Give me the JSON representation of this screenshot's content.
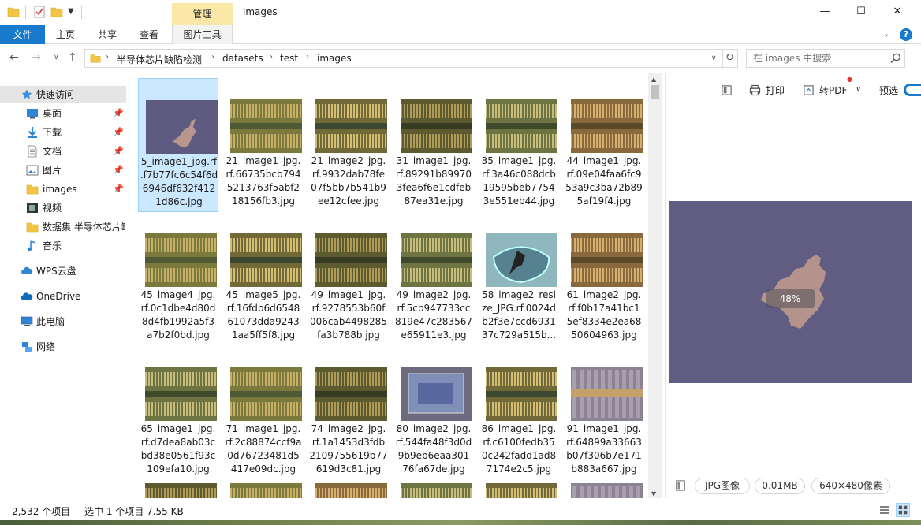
{
  "window": {
    "title": "images",
    "manage_tab": "管理",
    "min_glyph": "—",
    "max_glyph": "☐",
    "close_glyph": "✕"
  },
  "ribbon": {
    "tabs": [
      "文件",
      "主页",
      "共享",
      "查看",
      "图片工具"
    ],
    "file_tab_color": "#1979ca",
    "manage_tab_color": "#fbe7a8"
  },
  "navigation": {
    "breadcrumb": [
      "半导体芯片缺陷检测",
      "datasets",
      "test",
      "images"
    ],
    "search_placeholder": "在 images 中搜索"
  },
  "sidebar": {
    "items": [
      {
        "label": "快速访问",
        "icon": "star-icon",
        "pinned": false
      },
      {
        "label": "桌面",
        "icon": "desktop-icon",
        "pinned": true
      },
      {
        "label": "下载",
        "icon": "download-icon",
        "pinned": true
      },
      {
        "label": "文档",
        "icon": "document-icon",
        "pinned": true
      },
      {
        "label": "图片",
        "icon": "pictures-icon",
        "pinned": true
      },
      {
        "label": "images",
        "icon": "folder-icon",
        "pinned": true
      },
      {
        "label": "视频",
        "icon": "video-icon",
        "pinned": false
      },
      {
        "label": "数据集 半导体芯片缺",
        "icon": "folder-icon",
        "pinned": false
      },
      {
        "label": "音乐",
        "icon": "music-icon",
        "pinned": false
      },
      {
        "label": "WPS云盘",
        "icon": "cloud-icon",
        "pinned": false
      },
      {
        "label": "OneDrive",
        "icon": "onedrive-icon",
        "pinned": false
      },
      {
        "label": "此电脑",
        "icon": "computer-icon",
        "pinned": false
      },
      {
        "label": "网络",
        "icon": "network-icon",
        "pinned": false
      }
    ]
  },
  "files": [
    {
      "name": "5_image1_jpg.rf.f7b77fc6c54f6d6946df632f4121d86c.jpg",
      "lines": [
        "5_image1_jpg.rf",
        ".f7b77fc6c54f6d",
        "6946df632f412",
        "1d86c.jpg"
      ],
      "selected": true,
      "style": "blob"
    },
    {
      "name": "21_image1_jpg.rf.66735bcb7945213763f5abf218156fb3.jpg",
      "lines": [
        "21_image1_jpg.",
        "rf.66735bcb794",
        "5213763f5abf2",
        "18156fb3.jpg"
      ],
      "selected": false,
      "style": "chipa"
    },
    {
      "name": "21_image2_jpg.rf.9932dab78fe07f5bb7b541b9ee12cfee.jpg",
      "lines": [
        "21_image2_jpg.",
        "rf.9932dab78fe",
        "07f5bb7b541b9",
        "ee12cfee.jpg"
      ],
      "selected": false,
      "style": "chipb"
    },
    {
      "name": "31_image1_jpg.rf.892918b989703fea6f6e1cdfeb87ea31e.jpg",
      "lines": [
        "31_image1_jpg.",
        "rf.89291b89970",
        "3fea6f6e1cdfeb",
        "87ea31e.jpg"
      ],
      "selected": false,
      "style": "chipc"
    },
    {
      "name": "35_image1_jpg.rf.3a46c088dcb19595beb77543e551eb44.jpg",
      "lines": [
        "35_image1_jpg.",
        "rf.3a46c088dcb",
        "19595beb7754",
        "3e551eb44.jpg"
      ],
      "selected": false,
      "style": "chipd"
    },
    {
      "name": "44_image1_jpg.rf.09e04faa6fc953a9c3ba72b895af19f4.jpg",
      "lines": [
        "44_image1_jpg.",
        "rf.09e04faa6fc9",
        "53a9c3ba72b89",
        "5af19f4.jpg"
      ],
      "selected": false,
      "style": "chipe"
    },
    {
      "name": "45_image4_jpg.rf.0c1dbe4d80d8d4fb1992a5f3a7b2f0bd.jpg",
      "lines": [
        "45_image4_jpg.",
        "rf.0c1dbe4d80d",
        "8d4fb1992a5f3",
        "a7b2f0bd.jpg"
      ],
      "selected": false,
      "style": "chipa"
    },
    {
      "name": "45_image5_jpg.rf.16fdb6d654861073dda92431aa5ff5f8.jpg",
      "lines": [
        "45_image5_jpg.",
        "rf.16fdb6d6548",
        "61073dda9243",
        "1aa5ff5f8.jpg"
      ],
      "selected": false,
      "style": "chipb"
    },
    {
      "name": "49_image1_jpg.rf.9278553b60f006cab4498285fa3b788b.jpg",
      "lines": [
        "49_image1_jpg.",
        "rf.9278553b60f",
        "006cab4498285",
        "fa3b788b.jpg"
      ],
      "selected": false,
      "style": "chipc"
    },
    {
      "name": "49_image2_jpg.rf.5cb947733cc819e47c283567e65911e3.jpg",
      "lines": [
        "49_image2_jpg.",
        "rf.5cb947733cc",
        "819e47c283567",
        "e65911e3.jpg"
      ],
      "selected": false,
      "style": "chipd"
    },
    {
      "name": "58_image2_resize_JPG.rf.0024db2f3e7ccd693137c729a515b...",
      "lines": [
        "58_image2_resi",
        "ze_JPG.rf.0024d",
        "b2f3e7ccd6931",
        "37c729a515b..."
      ],
      "selected": false,
      "style": "teal"
    },
    {
      "name": "61_image2_jpg.rf.f0b17a41bc15ef8334e2ea6850604963.jpg",
      "lines": [
        "61_image2_jpg.",
        "rf.f0b17a41bc1",
        "5ef8334e2ea68",
        "50604963.jpg"
      ],
      "selected": false,
      "style": "chipe"
    },
    {
      "name": "65_image1_jpg.rf.d7dea8ab03cbd38e0561f93c109efa10.jpg",
      "lines": [
        "65_image1_jpg.",
        "rf.d7dea8ab03c",
        "bd38e0561f93c",
        "109efa10.jpg"
      ],
      "selected": false,
      "style": "chipd"
    },
    {
      "name": "71_image1_jpg.rf.2c88874ccf9a0d76723481d5417e09dc.jpg",
      "lines": [
        "71_image1_jpg.",
        "rf.2c88874ccf9a",
        "0d76723481d5",
        "417e09dc.jpg"
      ],
      "selected": false,
      "style": "chipa"
    },
    {
      "name": "74_image2_jpg.rf.1a1453d3fdb2109755619b77619d3c81.jpg",
      "lines": [
        "74_image2_jpg.",
        "rf.1a1453d3fdb",
        "2109755619b77",
        "619d3c81.jpg"
      ],
      "selected": false,
      "style": "chipc"
    },
    {
      "name": "80_image2_jpg.rf.544fa48f3d0d9b9eb6eaa30176fa67de.jpg",
      "lines": [
        "80_image2_jpg.",
        "rf.544fa48f3d0d",
        "9b9eb6eaa301",
        "76fa67de.jpg"
      ],
      "selected": false,
      "style": "blue"
    },
    {
      "name": "86_image1_jpg.rf.c6100fedb350c242fadd1ad87174e2c5.jpg",
      "lines": [
        "86_image1_jpg.",
        "rf.c6100fedb35",
        "0c242fadd1ad8",
        "7174e2c5.jpg"
      ],
      "selected": false,
      "style": "chipb"
    },
    {
      "name": "91_image1_jpg.rf.64899a33663b07f306b7e171b883a667.jpg",
      "lines": [
        "91_image1_jpg.",
        "rf.64899a33663",
        "b07f306b7e171",
        "b883a667.jpg"
      ],
      "selected": false,
      "style": "purple"
    }
  ],
  "preview": {
    "print_label": "打印",
    "topdf_label": "转PDF",
    "preview_label": "预选",
    "zoom": "48%",
    "file_type": "JPG图像",
    "file_size": "0.01MB",
    "dimensions": "640×480像素",
    "background_color": "#615d82"
  },
  "status": {
    "item_count": "2,532 个项目",
    "selection": "选中 1 个项目  7.55 KB"
  }
}
